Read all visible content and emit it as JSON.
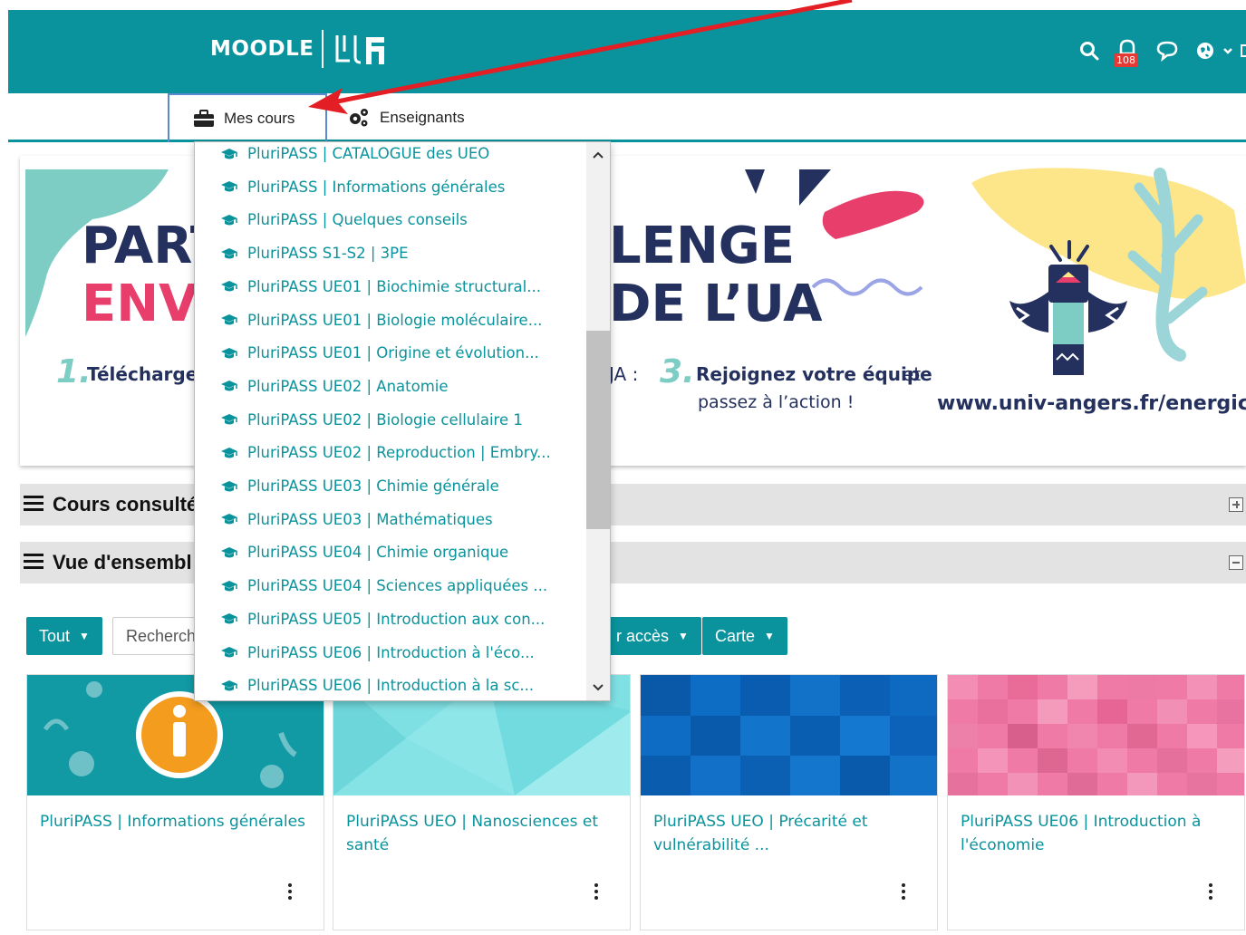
{
  "header": {
    "brand": "MOODLE",
    "notification_count": "108",
    "icons": [
      "search-icon",
      "bell-icon",
      "chat-icon",
      "globe-icon",
      "chevron-down-icon"
    ]
  },
  "subnav": {
    "tabs": [
      {
        "label": "Mes cours",
        "icon": "briefcase-icon"
      },
      {
        "label": "Enseignants",
        "icon": "gears-icon"
      }
    ]
  },
  "banner": {
    "headline_1a": "PART",
    "headline_1b": "LENGE",
    "headline_2a": "ENVI",
    "headline_2b": "DE L’UA",
    "step1_num": "1.",
    "step1_text": "Téléchargez",
    "step2_fragment": "JA :",
    "step3_num": "3.",
    "step3_text_bold": "Rejoignez votre équipe",
    "step3_text_rest": "et",
    "step3_line2": "passez à l’action !",
    "url": "www.univ-angers.fr/energic"
  },
  "sections": [
    {
      "title": "Cours consulté",
      "toggle": "expand"
    },
    {
      "title": "Vue d'ensembl",
      "toggle": "collapse"
    }
  ],
  "filters": {
    "all_label": "Tout",
    "search_placeholder": "Recherch",
    "sort_label": "r accès",
    "view_label": "Carte"
  },
  "dropdown": {
    "items": [
      "PluriPASS | CATALOGUE des UEO",
      "PluriPASS | Informations générales",
      "PluriPASS | Quelques conseils",
      "PluriPASS S1-S2 | 3PE",
      "PluriPASS UE01 | Biochimie structural...",
      "PluriPASS UE01 | Biologie moléculaire...",
      "PluriPASS UE01 | Origine et évolution...",
      "PluriPASS UE02 | Anatomie",
      "PluriPASS UE02 | Biologie cellulaire 1",
      "PluriPASS UE02 | Reproduction | Embry...",
      "PluriPASS UE03 | Chimie générale",
      "PluriPASS UE03 | Mathématiques",
      "PluriPASS UE04 | Chimie organique",
      "PluriPASS UE04 | Sciences appliquées ...",
      "PluriPASS UE05 | Introduction aux con...",
      "PluriPASS UE06 | Introduction à l'éco...",
      "PluriPASS UE06 | Introduction à la sc..."
    ]
  },
  "cards": [
    {
      "title": "PluriPASS | Informations générales"
    },
    {
      "title": "PluriPASS UEO | Nanosciences et santé"
    },
    {
      "title": "PluriPASS UEO | Précarité et vulnérabilité ..."
    },
    {
      "title": "PluriPASS UE06 | Introduction à l'économie"
    }
  ],
  "colors": {
    "brand_teal": "#0a939c",
    "annotation_red": "#e31e24",
    "badge_red": "#e53935"
  }
}
